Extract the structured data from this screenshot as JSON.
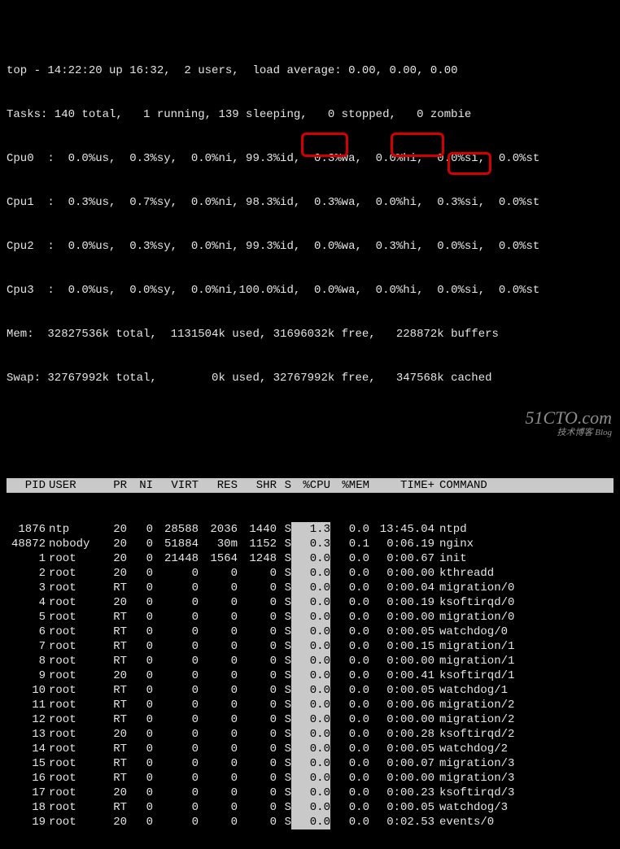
{
  "summary": {
    "line1": "top - 14:22:20 up 16:32,  2 users,  load average: 0.00, 0.00, 0.00",
    "line2": "Tasks: 140 total,   1 running, 139 sleeping,   0 stopped,   0 zombie",
    "cpu0": "Cpu0  :  0.0%us,  0.3%sy,  0.0%ni, 99.3%id,  0.3%wa,  0.0%hi,  0.0%si,  0.0%st",
    "cpu1": "Cpu1  :  0.3%us,  0.7%sy,  0.0%ni, 98.3%id,  0.3%wa,  0.0%hi,  0.3%si,  0.0%st",
    "cpu2": "Cpu2  :  0.0%us,  0.3%sy,  0.0%ni, 99.3%id,  0.0%wa,  0.3%hi,  0.0%si,  0.0%st",
    "cpu3": "Cpu3  :  0.0%us,  0.0%sy,  0.0%ni,100.0%id,  0.0%wa,  0.0%hi,  0.0%si,  0.0%st",
    "mem": "Mem:  32827536k total,  1131504k used, 31696032k free,   228872k buffers",
    "swap": "Swap: 32767992k total,        0k used, 32767992k free,   347568k cached"
  },
  "headers": {
    "pid": "PID",
    "user": "USER",
    "pr": "PR",
    "ni": "NI",
    "virt": "VIRT",
    "res": "RES",
    "shr": "SHR",
    "s": "S",
    "cpu": "%CPU",
    "mem": "%MEM",
    "time": "TIME+",
    "cmd": "COMMAND"
  },
  "procs": [
    {
      "pid": "1876",
      "user": "ntp",
      "pr": "20",
      "ni": "0",
      "virt": "28588",
      "res": "2036",
      "shr": "1440",
      "s": "S",
      "cpu": "1.3",
      "mem": "0.0",
      "time": "13:45.04",
      "cmd": "ntpd"
    },
    {
      "pid": "48872",
      "user": "nobody",
      "pr": "20",
      "ni": "0",
      "virt": "51884",
      "res": "30m",
      "shr": "1152",
      "s": "S",
      "cpu": "0.3",
      "mem": "0.1",
      "time": "0:06.19",
      "cmd": "nginx"
    },
    {
      "pid": "1",
      "user": "root",
      "pr": "20",
      "ni": "0",
      "virt": "21448",
      "res": "1564",
      "shr": "1248",
      "s": "S",
      "cpu": "0.0",
      "mem": "0.0",
      "time": "0:00.67",
      "cmd": "init"
    },
    {
      "pid": "2",
      "user": "root",
      "pr": "20",
      "ni": "0",
      "virt": "0",
      "res": "0",
      "shr": "0",
      "s": "S",
      "cpu": "0.0",
      "mem": "0.0",
      "time": "0:00.00",
      "cmd": "kthreadd"
    },
    {
      "pid": "3",
      "user": "root",
      "pr": "RT",
      "ni": "0",
      "virt": "0",
      "res": "0",
      "shr": "0",
      "s": "S",
      "cpu": "0.0",
      "mem": "0.0",
      "time": "0:00.04",
      "cmd": "migration/0"
    },
    {
      "pid": "4",
      "user": "root",
      "pr": "20",
      "ni": "0",
      "virt": "0",
      "res": "0",
      "shr": "0",
      "s": "S",
      "cpu": "0.0",
      "mem": "0.0",
      "time": "0:00.19",
      "cmd": "ksoftirqd/0"
    },
    {
      "pid": "5",
      "user": "root",
      "pr": "RT",
      "ni": "0",
      "virt": "0",
      "res": "0",
      "shr": "0",
      "s": "S",
      "cpu": "0.0",
      "mem": "0.0",
      "time": "0:00.00",
      "cmd": "migration/0"
    },
    {
      "pid": "6",
      "user": "root",
      "pr": "RT",
      "ni": "0",
      "virt": "0",
      "res": "0",
      "shr": "0",
      "s": "S",
      "cpu": "0.0",
      "mem": "0.0",
      "time": "0:00.05",
      "cmd": "watchdog/0"
    },
    {
      "pid": "7",
      "user": "root",
      "pr": "RT",
      "ni": "0",
      "virt": "0",
      "res": "0",
      "shr": "0",
      "s": "S",
      "cpu": "0.0",
      "mem": "0.0",
      "time": "0:00.15",
      "cmd": "migration/1"
    },
    {
      "pid": "8",
      "user": "root",
      "pr": "RT",
      "ni": "0",
      "virt": "0",
      "res": "0",
      "shr": "0",
      "s": "S",
      "cpu": "0.0",
      "mem": "0.0",
      "time": "0:00.00",
      "cmd": "migration/1"
    },
    {
      "pid": "9",
      "user": "root",
      "pr": "20",
      "ni": "0",
      "virt": "0",
      "res": "0",
      "shr": "0",
      "s": "S",
      "cpu": "0.0",
      "mem": "0.0",
      "time": "0:00.41",
      "cmd": "ksoftirqd/1"
    },
    {
      "pid": "10",
      "user": "root",
      "pr": "RT",
      "ni": "0",
      "virt": "0",
      "res": "0",
      "shr": "0",
      "s": "S",
      "cpu": "0.0",
      "mem": "0.0",
      "time": "0:00.05",
      "cmd": "watchdog/1"
    },
    {
      "pid": "11",
      "user": "root",
      "pr": "RT",
      "ni": "0",
      "virt": "0",
      "res": "0",
      "shr": "0",
      "s": "S",
      "cpu": "0.0",
      "mem": "0.0",
      "time": "0:00.06",
      "cmd": "migration/2"
    },
    {
      "pid": "12",
      "user": "root",
      "pr": "RT",
      "ni": "0",
      "virt": "0",
      "res": "0",
      "shr": "0",
      "s": "S",
      "cpu": "0.0",
      "mem": "0.0",
      "time": "0:00.00",
      "cmd": "migration/2"
    },
    {
      "pid": "13",
      "user": "root",
      "pr": "20",
      "ni": "0",
      "virt": "0",
      "res": "0",
      "shr": "0",
      "s": "S",
      "cpu": "0.0",
      "mem": "0.0",
      "time": "0:00.28",
      "cmd": "ksoftirqd/2"
    },
    {
      "pid": "14",
      "user": "root",
      "pr": "RT",
      "ni": "0",
      "virt": "0",
      "res": "0",
      "shr": "0",
      "s": "S",
      "cpu": "0.0",
      "mem": "0.0",
      "time": "0:00.05",
      "cmd": "watchdog/2"
    },
    {
      "pid": "15",
      "user": "root",
      "pr": "RT",
      "ni": "0",
      "virt": "0",
      "res": "0",
      "shr": "0",
      "s": "S",
      "cpu": "0.0",
      "mem": "0.0",
      "time": "0:00.07",
      "cmd": "migration/3"
    },
    {
      "pid": "16",
      "user": "root",
      "pr": "RT",
      "ni": "0",
      "virt": "0",
      "res": "0",
      "shr": "0",
      "s": "S",
      "cpu": "0.0",
      "mem": "0.0",
      "time": "0:00.00",
      "cmd": "migration/3"
    },
    {
      "pid": "17",
      "user": "root",
      "pr": "20",
      "ni": "0",
      "virt": "0",
      "res": "0",
      "shr": "0",
      "s": "S",
      "cpu": "0.0",
      "mem": "0.0",
      "time": "0:00.23",
      "cmd": "ksoftirqd/3"
    },
    {
      "pid": "18",
      "user": "root",
      "pr": "RT",
      "ni": "0",
      "virt": "0",
      "res": "0",
      "shr": "0",
      "s": "S",
      "cpu": "0.0",
      "mem": "0.0",
      "time": "0:00.05",
      "cmd": "watchdog/3"
    },
    {
      "pid": "19",
      "user": "root",
      "pr": "20",
      "ni": "0",
      "virt": "0",
      "res": "0",
      "shr": "0",
      "s": "S",
      "cpu": "0.0",
      "mem": "0.0",
      "time": "0:02.53",
      "cmd": "events/0"
    }
  ],
  "watermark": {
    "main": "51CTO.com",
    "sub": "技术博客      Blog"
  }
}
